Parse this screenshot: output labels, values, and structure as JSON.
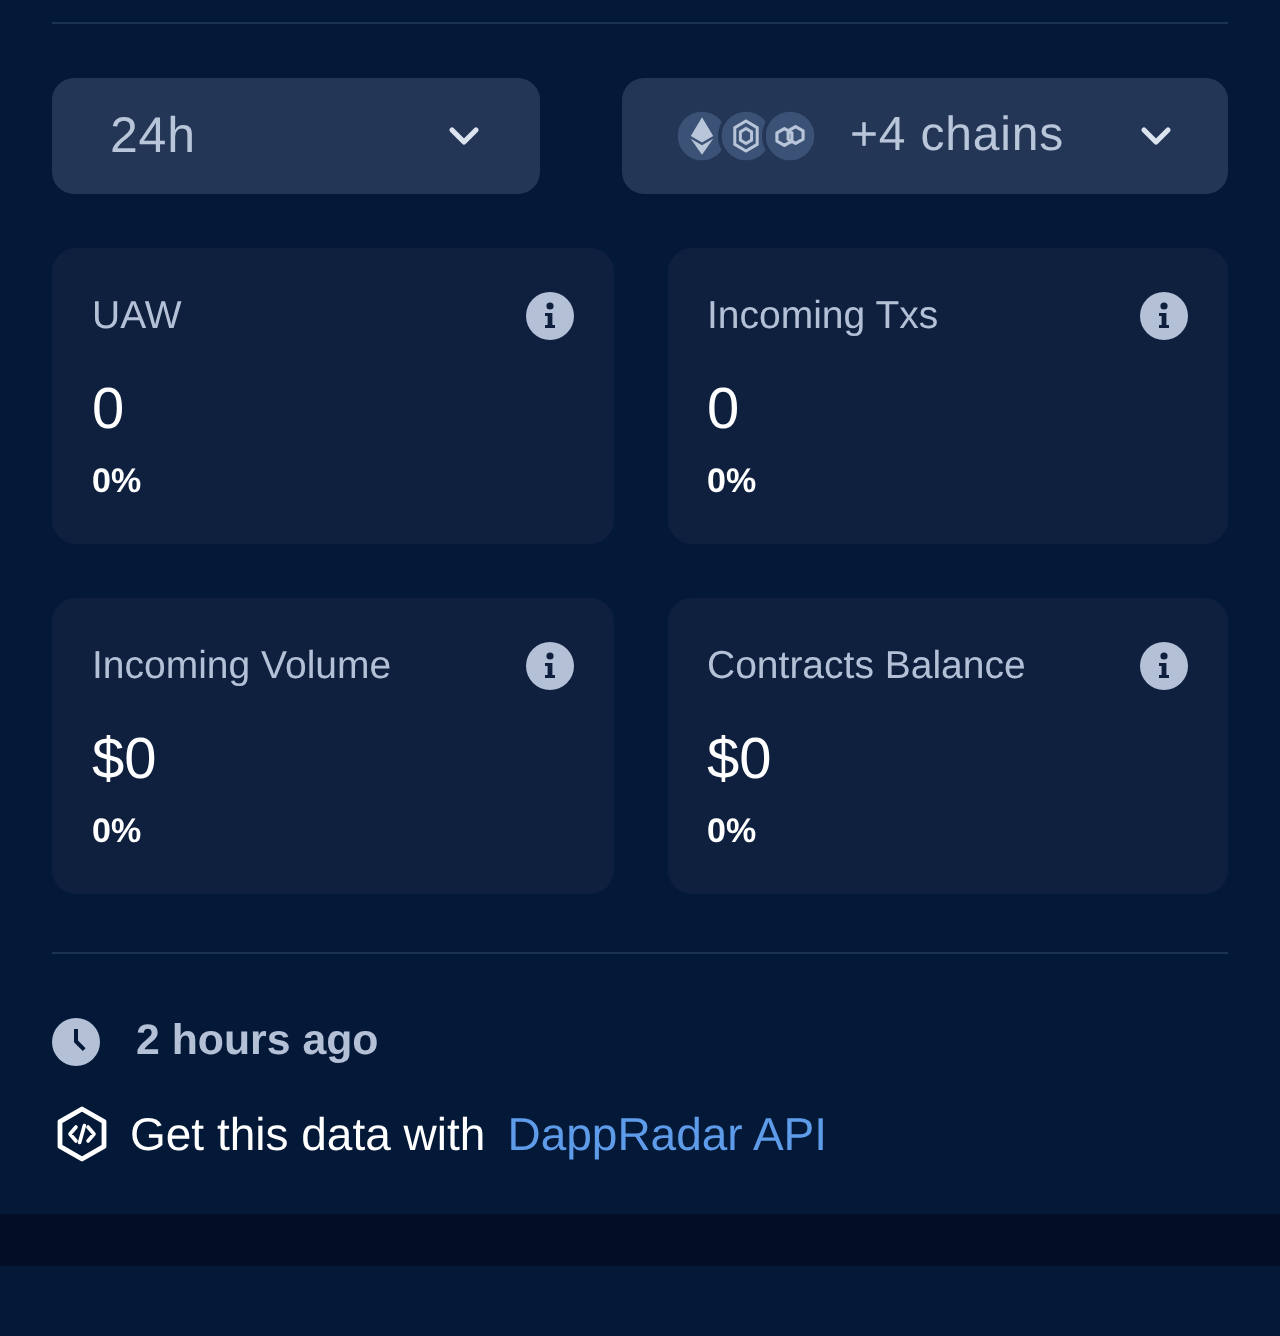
{
  "filters": [
    {
      "kind": "period",
      "label": "24h"
    },
    {
      "kind": "chains",
      "label": "+4 chains"
    }
  ],
  "stats": [
    {
      "title": "UAW",
      "value": "0",
      "change": "0%"
    },
    {
      "title": "Incoming Txs",
      "value": "0",
      "change": "0%"
    },
    {
      "title": "Incoming Volume",
      "value": "$0",
      "change": "0%"
    },
    {
      "title": "Contracts Balance",
      "value": "$0",
      "change": "0%"
    }
  ],
  "updated": "2 hours ago",
  "api_note": {
    "text": "Get this data with",
    "link": "DappRadar API"
  }
}
